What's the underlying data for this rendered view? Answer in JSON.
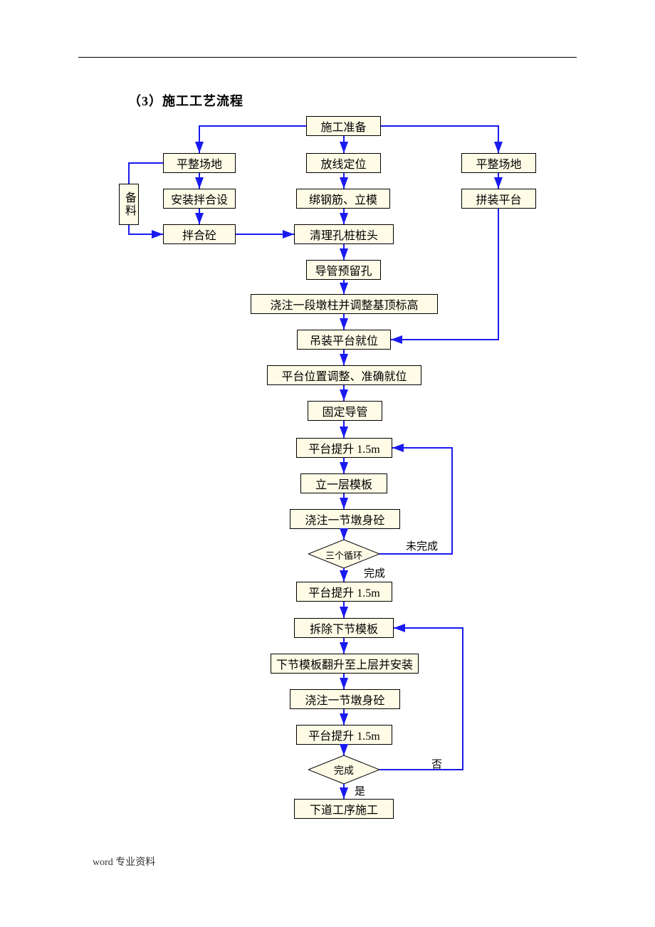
{
  "heading": "（3）施工工艺流程",
  "footer": "word 专业资料",
  "nodes": {
    "beiliao": "备料",
    "l1": "平整场地",
    "l2": "安装拌合设",
    "l3": "拌合砼",
    "c1": "施工准备",
    "c2": "放线定位",
    "c3": "绑钢筋、立模",
    "c4": "清理孔桩桩头",
    "c5": "导管预留孔",
    "c6": "浇注一段墩柱并调整基顶标高",
    "c7": "吊装平台就位",
    "c8": "平台位置调整、准确就位",
    "c9": "固定导管",
    "c10": "平台提升 1.5m",
    "c11": "立一层模板",
    "c12": "浇注一节墩身砼",
    "d1": "三个循环",
    "c13": "平台提升 1.5m",
    "c14": "拆除下节模板",
    "c15": "下节模板翻升至上层并安装",
    "c16": "浇注一节墩身砼",
    "c17": "平台提升 1.5m",
    "d2": "完成",
    "c18": "下道工序施工",
    "r1": "平整场地",
    "r2": "拼装平台",
    "label_unfinished": "未完成",
    "label_finished": "完成",
    "label_no": "否",
    "label_yes": "是"
  }
}
